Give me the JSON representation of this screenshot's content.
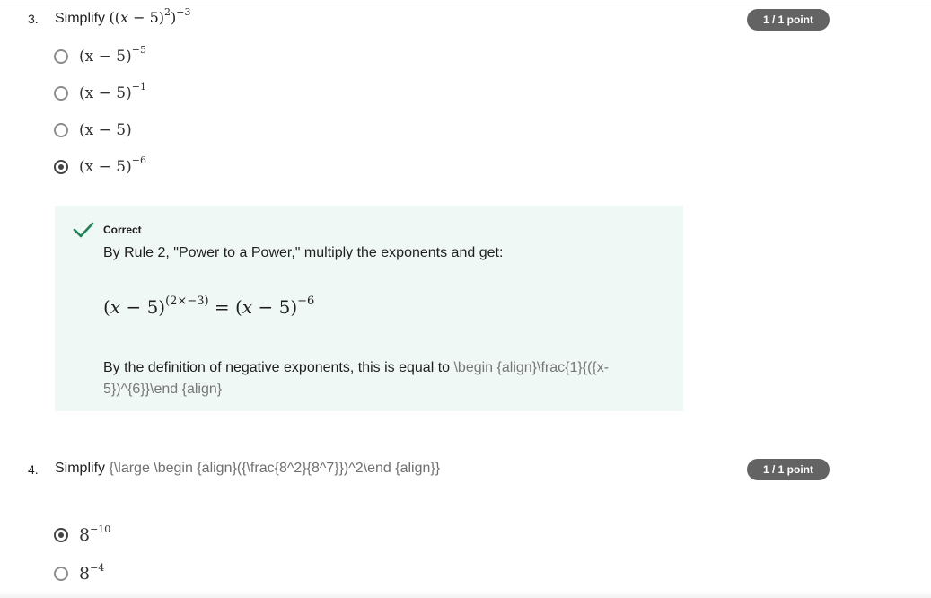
{
  "question3": {
    "number": "3.",
    "prompt_prefix": "Simplify",
    "score": "1 / 1 point",
    "options": [
      {
        "base": "(x − 5)",
        "exp": "−5",
        "selected": false
      },
      {
        "base": "(x − 5)",
        "exp": "−1",
        "selected": false
      },
      {
        "base": "(x − 5)",
        "exp": "",
        "selected": false
      },
      {
        "base": "(x − 5)",
        "exp": "−6",
        "selected": true
      }
    ],
    "feedback": {
      "status": "Correct",
      "explanation": "By Rule 2, \"Power to a Power,\" multiply the exponents and get:",
      "definition_prefix": "By the definition of negative exponents, this is equal to",
      "definition_raw": "\\begin {align}\\frac{1}{({x-5})^{6}}\\end {align}"
    }
  },
  "question4": {
    "number": "4.",
    "prompt_prefix": "Simplify",
    "prompt_raw": "{\\large \\begin {align}({\\frac{8^2}{8^7}})^2\\end {align}}",
    "score": "1 / 1 point",
    "options": [
      {
        "base": "8",
        "exp": "−10",
        "selected": true
      },
      {
        "base": "8",
        "exp": "−4",
        "selected": false
      }
    ]
  },
  "colors": {
    "badge_bg": "#636363",
    "feedback_bg": "#f0f8f6",
    "check_green": "#1f8354"
  },
  "icons": {
    "correct": "check-icon"
  }
}
